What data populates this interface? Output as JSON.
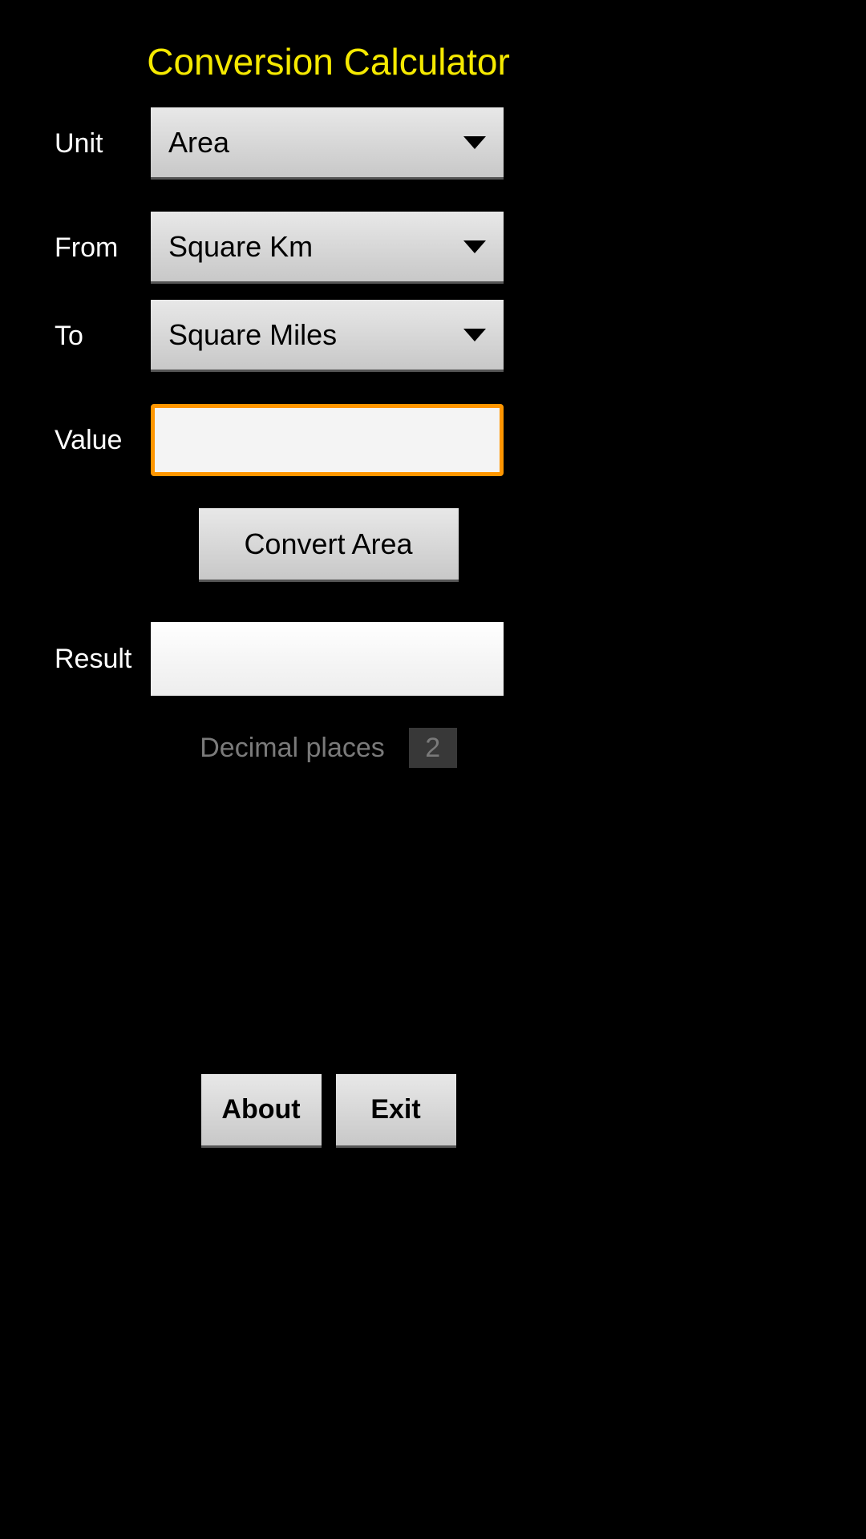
{
  "title": "Conversion Calculator",
  "labels": {
    "unit": "Unit",
    "from": "From",
    "to": "To",
    "value": "Value",
    "result": "Result",
    "decimal_places": "Decimal places"
  },
  "dropdowns": {
    "unit": "Area",
    "from": "Square Km",
    "to": "Square Miles"
  },
  "value_input": "",
  "convert_button": "Convert Area",
  "result_value": "",
  "decimal_places_value": "2",
  "buttons": {
    "about": "About",
    "exit": "Exit"
  }
}
